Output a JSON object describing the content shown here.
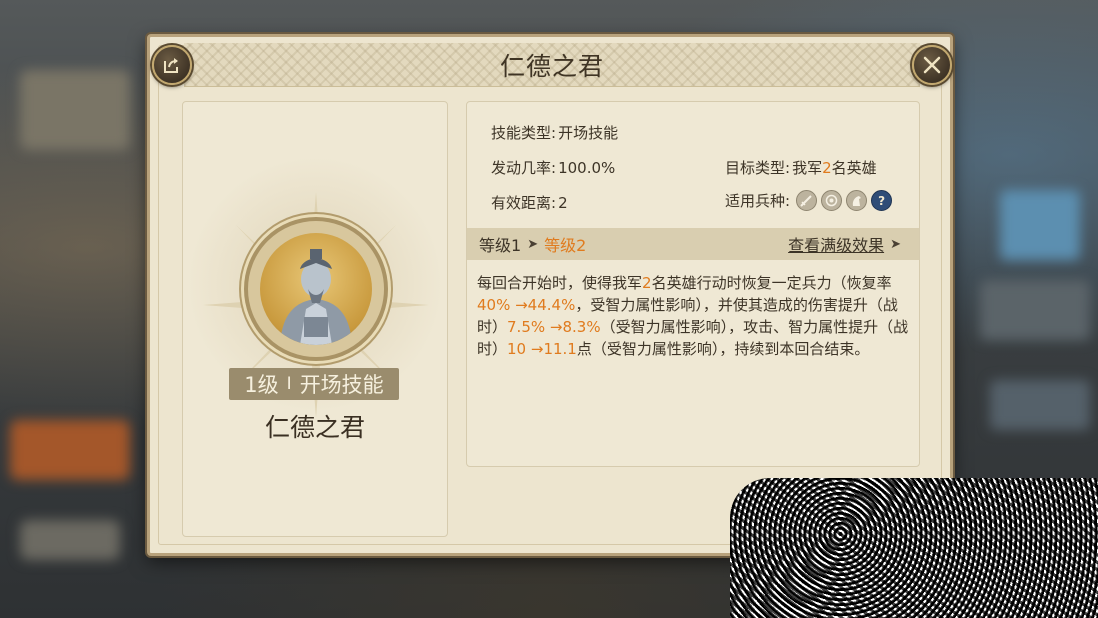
{
  "title": "仁德之君",
  "left_card": {
    "level_text": "1级",
    "separator": "I",
    "skill_type_badge": "开场技能",
    "skill_name": "仁德之君"
  },
  "info": {
    "skill_type_label": "技能类型:",
    "skill_type_value": "开场技能",
    "trigger_rate_label": "发动几率:",
    "trigger_rate_value": "100.0%",
    "distance_label": "有效距离:",
    "distance_value": "2",
    "target_label": "目标类型:",
    "target_prefix": "我军",
    "target_count": "2",
    "target_suffix": "名英雄",
    "troop_label": "适用兵种:",
    "troop_icons": [
      "sword-icon",
      "bow-target-icon",
      "horse-icon",
      "question-icon"
    ],
    "troop_question_glyph": "?"
  },
  "level_bar": {
    "current": "等级1",
    "next": "等级2",
    "view_max": "查看满级效果"
  },
  "description": {
    "p1": "每回合开始时，使得我军",
    "p1_num": "2",
    "p2": "名英雄行动时恢复一定兵力（恢复率",
    "p2_num": "40% →44.4%",
    "p3": "，受智力属性影响），并使其造成的伤害提升（战时）",
    "p3_num": "7.5% →8.3%",
    "p4": "（受智力属性影响），攻击、智力属性提升（战时）",
    "p4_num": "10 →11.1",
    "p5": "点（受智力属性影响），持续到本回合结束。"
  },
  "colors": {
    "accent_orange": "#e07b1e",
    "panel_bg": "#ede5cf",
    "troop_question_bg": "#2f4d77"
  }
}
